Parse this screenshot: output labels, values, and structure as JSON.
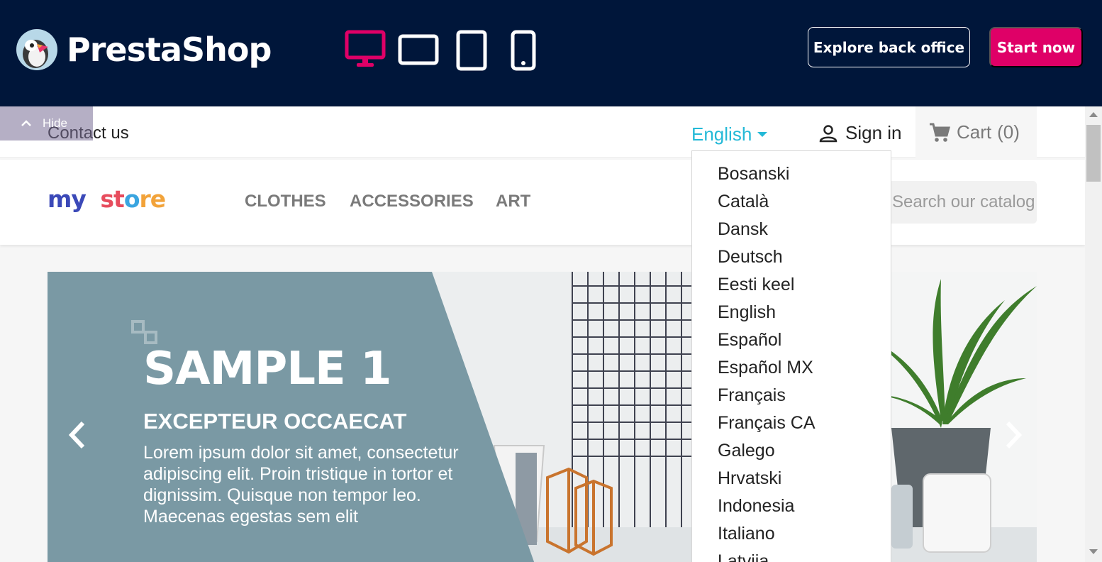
{
  "demo_bar": {
    "brand": "PrestaShop",
    "devices": [
      "desktop-icon",
      "tablet-landscape-icon",
      "tablet-portrait-icon",
      "mobile-icon"
    ],
    "active_device_color": "#df0067",
    "explore_label": "Explore back office",
    "start_label": "Start now",
    "background": "#00163a"
  },
  "store": {
    "hide_label": "Hide",
    "contact_label": "Contact us",
    "language_current": "English",
    "signin_label": "Sign in",
    "cart_label": "Cart",
    "cart_count": "(0)",
    "logo": {
      "part1": "my",
      "part2": "st",
      "part3": "o",
      "part4": "re"
    },
    "menu": [
      "CLOTHES",
      "ACCESSORIES",
      "ART"
    ],
    "search_placeholder": "Search our catalog",
    "accent": "#24b9d7"
  },
  "slider": {
    "title": "SAMPLE 1",
    "subtitle": "EXCEPTEUR OCCAECAT",
    "text": "Lorem ipsum dolor sit amet, consectetur adipiscing elit. Proin tristique in tortor et dignissim. Quisque non tempor leo. Maecenas egestas sem elit"
  },
  "languages": [
    "Bosanski",
    "Català",
    "Dansk",
    "Deutsch",
    "Eesti keel",
    "English",
    "Español",
    "Español MX",
    "Français",
    "Français CA",
    "Galego",
    "Hrvatski",
    "Indonesia",
    "Italiano",
    "Latvija"
  ]
}
